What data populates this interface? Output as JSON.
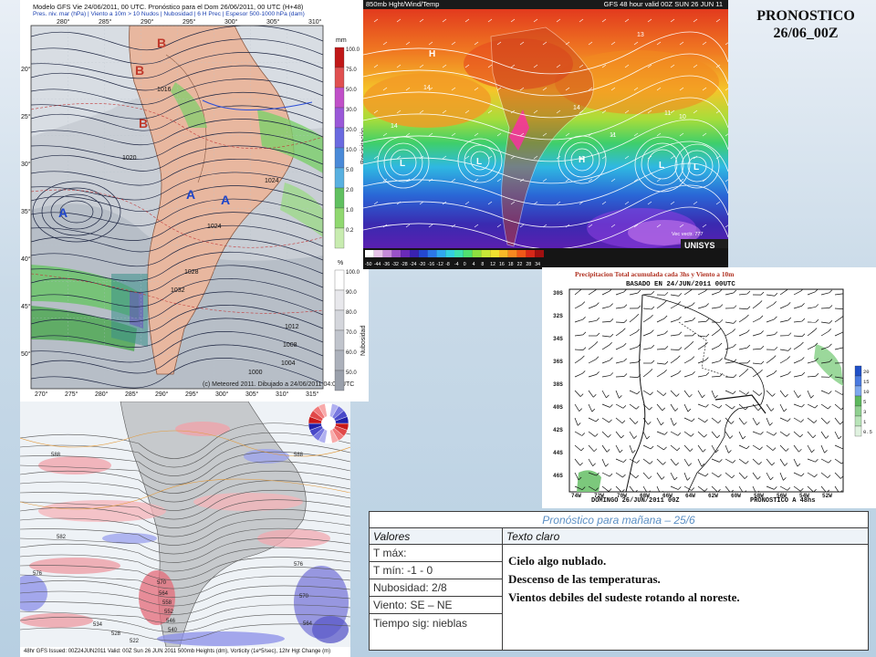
{
  "page": {
    "title_line1": "PRONOSTICO",
    "title_line2": "26/06_00Z"
  },
  "gfs_map": {
    "header_line1": "Modelo GFS Vie 24/06/2011, 00 UTC. Pronóstico para el Dom 26/06/2011, 00 UTC (H+48)",
    "header_line2": "Pres. niv. mar (hPa) | Viento a 10m > 10 Nudos | Nubosidad | 6 H Prec | Espesor 500-1000 hPa (dam)",
    "footer": "(c) Meteored 2011. Dibujado a 24/06/2011 04:02 UTC",
    "precip_units": "mm",
    "precip_label": "Precipitación",
    "cloud_units": "%",
    "cloud_label": "Nubosidad",
    "precip_ticks": [
      "100.0",
      "75.0",
      "50.0",
      "30.0",
      "20.0",
      "10.0",
      "5.0",
      "2.0",
      "1.0",
      "0.2"
    ],
    "cloud_ticks": [
      "100.0",
      "90.0",
      "80.0",
      "70.0",
      "60.0",
      "50.0"
    ],
    "lat_labels": [
      "20°",
      "25°",
      "30°",
      "35°",
      "40°",
      "45°",
      "50°"
    ],
    "lon_top": [
      "280°",
      "285°",
      "290°",
      "295°",
      "300°",
      "305°",
      "310°"
    ],
    "lon_bottom": [
      "270°",
      "275°",
      "280°",
      "285°",
      "290°",
      "295°",
      "300°",
      "305°",
      "310°",
      "315°"
    ],
    "pressure_centers": [
      "B",
      "B",
      "B",
      "A",
      "A",
      "A"
    ],
    "isobar_labels": [
      "1016",
      "1020",
      "1024",
      "1028",
      "1032",
      "1024",
      "1012",
      "1008",
      "1004",
      "1000"
    ]
  },
  "unisys_map": {
    "header_left": "850mb Hght/Wind/Temp",
    "header_right": "GFS 48 hour valid 00Z SUN 26 JUN 11",
    "logo": "UNISYS",
    "vector_note": "Vec vectr. 777",
    "scale_labels": [
      "-50",
      "-44",
      "-36",
      "-32",
      "-28",
      "-24",
      "-20",
      "-16",
      "-12",
      "-8",
      "-4",
      "0",
      "4",
      "8",
      "12",
      "16",
      "18",
      "22",
      "28",
      "34"
    ],
    "scale_colors": [
      "#ffffff",
      "#e6c3e8",
      "#c58ad8",
      "#9a52c8",
      "#6a2ab8",
      "#3a22b0",
      "#2448d0",
      "#2c78e8",
      "#30a8f0",
      "#34d0e0",
      "#3ee0b0",
      "#50e070",
      "#8ee040",
      "#c8e838",
      "#f0e030",
      "#f8b828",
      "#f88820",
      "#f05818",
      "#d82818",
      "#a01010"
    ],
    "isoline_labels": [
      "14",
      "14",
      "11",
      "10",
      "13",
      "11",
      "14"
    ],
    "low_marks": [
      "L",
      "L",
      "L",
      "L",
      "H",
      "H"
    ]
  },
  "precip_map": {
    "header_line1": "Precipitacion Total acumulada cada 3hs y Viento a 10m",
    "header_line2": "BASADO EN  24/JUN/2011 00UTC",
    "footer_left": "DOMINGO  26/JUN/2011 00Z",
    "footer_right": "PRONOSTICO A 48hs",
    "lat_labels": [
      "30S",
      "32S",
      "34S",
      "36S",
      "38S",
      "40S",
      "42S",
      "44S",
      "46S"
    ],
    "lon_labels": [
      "74W",
      "72W",
      "70W",
      "68W",
      "66W",
      "64W",
      "62W",
      "60W",
      "58W",
      "56W",
      "54W",
      "52W"
    ],
    "legend_values": [
      "20",
      "15",
      "10",
      "5",
      "3",
      "1",
      "0.5"
    ],
    "legend_colors": [
      "#2050c8",
      "#4a7ae0",
      "#7ea8ee",
      "#5cb85c",
      "#8fd08f",
      "#b8e4b8",
      "#e0f2e0"
    ]
  },
  "z500_map": {
    "footer": "48hr GFS Issued: 00Z24JUN2011  Valid: 00Z Sun 26 JUN 2011   500mb Heights (dm), Vorticity (1e*5/sec), 12hr Hgt Change (m)",
    "height_labels": [
      "588",
      "588",
      "582",
      "576",
      "570",
      "564",
      "558",
      "552",
      "546",
      "540",
      "534",
      "528",
      "522",
      "576",
      "570",
      "564"
    ]
  },
  "forecast": {
    "caption": "Pronóstico para mañana – 25/6",
    "col_values": "Valores",
    "col_text": "Texto claro",
    "rows": [
      "T máx:",
      "T mín: -1 - 0",
      "Nubosidad: 2/8",
      "Viento:   SE – NE",
      "Tiempo sig: nieblas"
    ],
    "text_lines": [
      "Cielo algo nublado.",
      "Descenso de las temperaturas.",
      "Vientos debiles del sudeste rotando al noreste."
    ]
  }
}
